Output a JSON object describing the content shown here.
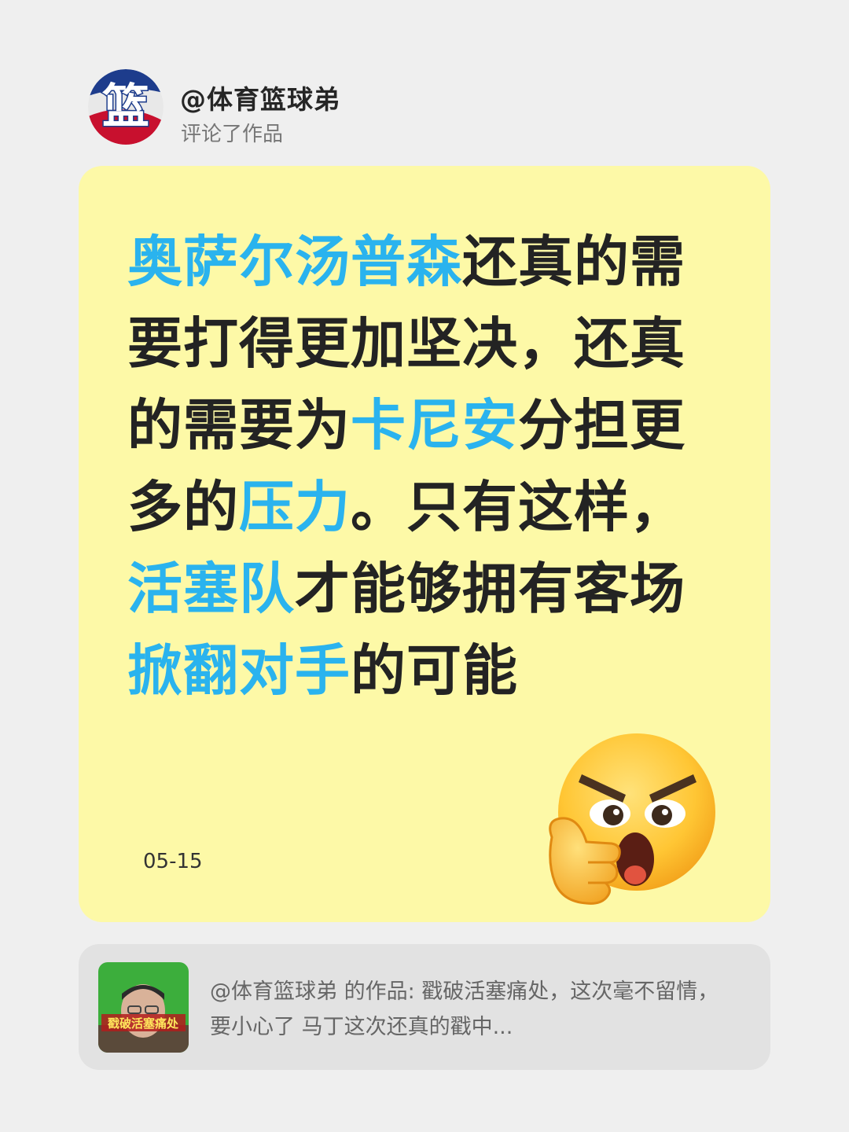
{
  "header": {
    "avatar_text": "篮",
    "username": "@体育篮球弟",
    "action": "评论了作品"
  },
  "comment": {
    "segments": [
      {
        "text": "奥萨尔汤普森",
        "highlight": true
      },
      {
        "text": "还真的需要打得更加坚决，还真的需要为",
        "highlight": false
      },
      {
        "text": "卡尼安",
        "highlight": true
      },
      {
        "text": "分担更多的",
        "highlight": false
      },
      {
        "text": "压力",
        "highlight": true
      },
      {
        "text": "。只有这样，",
        "highlight": false
      },
      {
        "text": "活塞队",
        "highlight": true
      },
      {
        "text": "才能够拥有客场",
        "highlight": false
      },
      {
        "text": "掀翻对手",
        "highlight": true
      },
      {
        "text": "的可能",
        "highlight": false
      }
    ],
    "date": "05-15",
    "emoji": "thinking-angry-face-emoji"
  },
  "source_work": {
    "thumbnail_caption": "戳破活塞痛处",
    "description": "@体育篮球弟 的作品: 戳破活塞痛处，这次毫不留情，要小心了 马丁这次还真的戳中..."
  },
  "colors": {
    "background": "#efefef",
    "card": "#fdf9a7",
    "highlight": "#2ab3ee",
    "text": "#232323",
    "source_card": "#e2e2e2"
  }
}
